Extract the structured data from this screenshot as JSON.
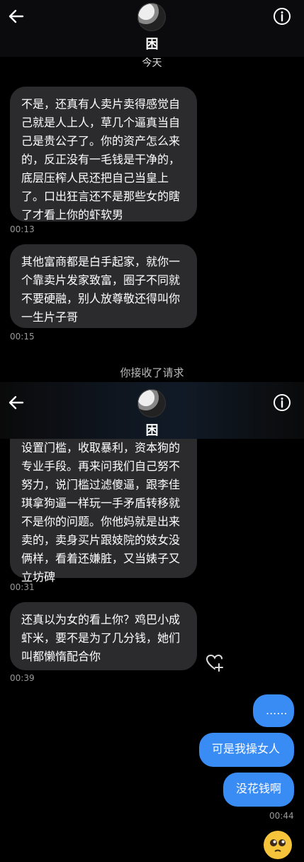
{
  "header": {
    "name": "困",
    "date": "今天"
  },
  "messages_top": [
    {
      "text": "不是，还真有人卖片卖得感觉自己就是人上人，草几个逼真当自己是贵公子了。你的资产怎么来的，反正没有一毛钱是干净的，底层压榨人民还把自己当皇上了。口出狂言还不是那些女的瞎了才看上你的虾软男",
      "time": "00:13"
    },
    {
      "text": "其他富商都是白手起家，就你一个靠卖片发家致富，圈子不同就不要硬融，别人放尊敬还得叫你一生片子哥",
      "time": "00:15"
    }
  ],
  "system_message": "你接收了请求",
  "messages_bottom": [
    {
      "text": "设置门槛，收取暴利，资本狗的专业手段。再来问我们自己努不努力，说门槛过滤傻逼，跟李佳琪拿狗逼一样玩一手矛盾转移就不是你的问题。你他妈就是出来卖的，卖身买片跟妓院的妓女没俩样，看着还嫌脏，又当婊子又立坊碑",
      "time": "00:31"
    },
    {
      "text": "还真以为女的看上你？鸡巴小成虾米，要不是为了几分钱，她们叫都懒惰配合你",
      "time": "00:39"
    }
  ],
  "outgoing": [
    {
      "text": "......"
    },
    {
      "text": "可是我操女人"
    },
    {
      "text": "没花钱啊"
    }
  ],
  "outgoing_time": "00:44",
  "icons": {
    "back": "back-arrow-icon",
    "info": "info-icon",
    "heart": "heart-plus-icon",
    "emoji": "pleading-face-emoji"
  },
  "colors": {
    "incoming_bubble": "#2b2b2e",
    "outgoing_bubble": "#3a8cf5"
  }
}
